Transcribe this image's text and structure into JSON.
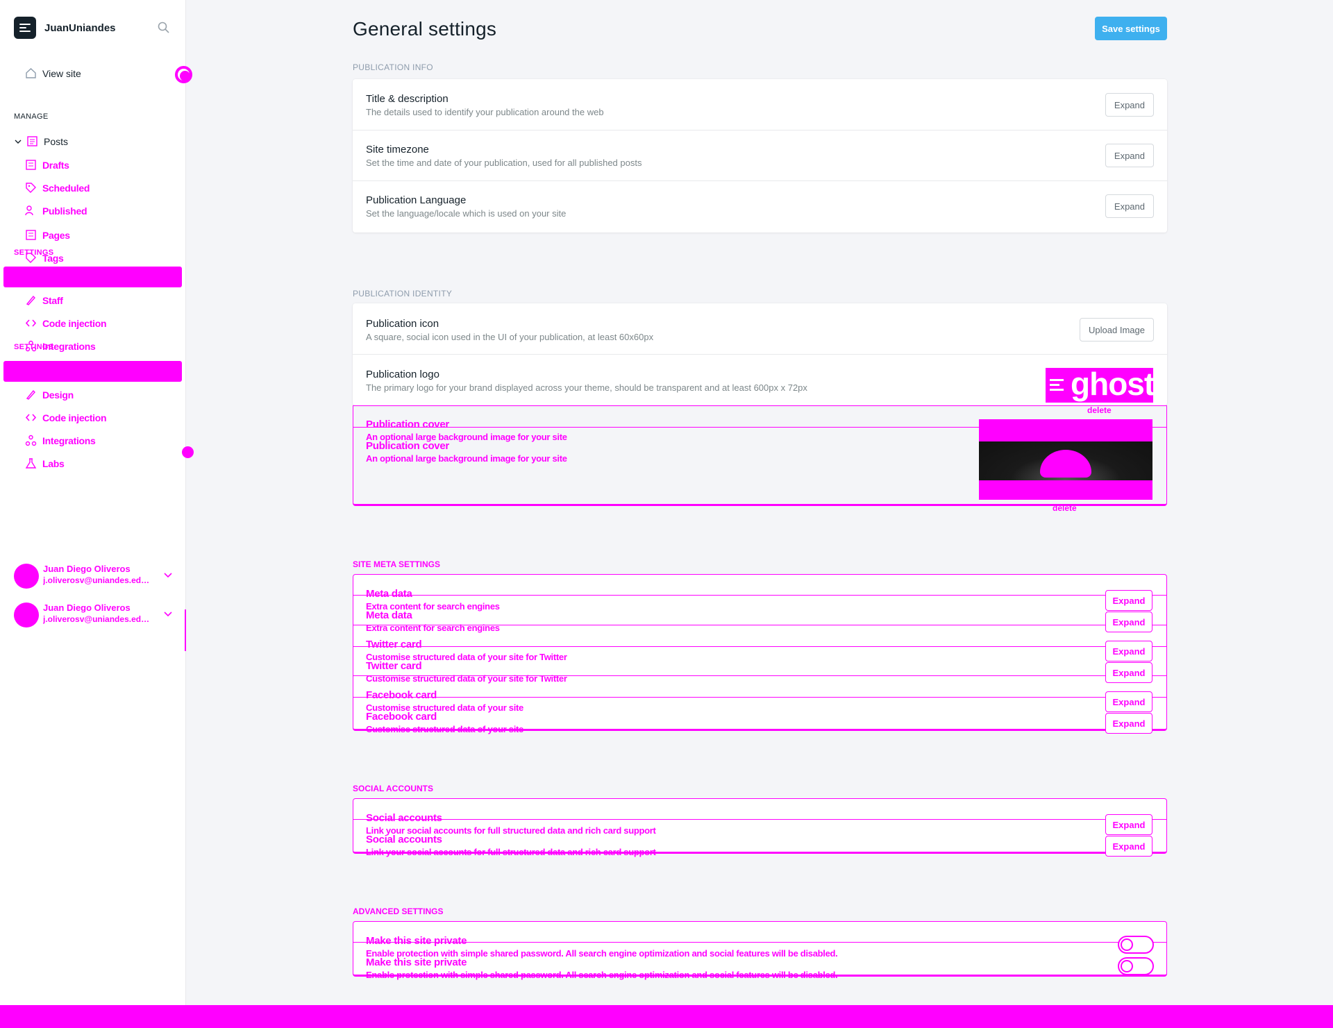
{
  "sidebar": {
    "brand": "JuanUniandes",
    "view_site": "View site",
    "manage_heading": "MANAGE",
    "posts": "Posts",
    "drafts": "Drafts",
    "scheduled": "Scheduled",
    "published": "Published",
    "pages": "Pages",
    "settings_heading": "SETTINGS",
    "tags": "Tags",
    "staff": "Staff",
    "design": "Design",
    "code_injection": "Code injection",
    "integrations": "Integrations",
    "labs": "Labs",
    "user": {
      "name": "Juan Diego Oliveros",
      "email": "j.oliverosv@uniandes.edu.co"
    }
  },
  "main": {
    "title": "General settings",
    "save_label": "Save settings",
    "expand_label": "Expand",
    "publication_info": {
      "label": "PUBLICATION INFO",
      "rows": [
        {
          "title": "Title & description",
          "desc": "The details used to identify your publication around the web"
        },
        {
          "title": "Site timezone",
          "desc": "Set the time and date of your publication, used for all published posts"
        },
        {
          "title": "Publication Language",
          "desc": "Set the language/locale which is used on your site"
        }
      ]
    },
    "publication_identity": {
      "label": "PUBLICATION IDENTITY",
      "icon_title": "Publication icon",
      "icon_desc": "A square, social icon used in the UI of your publication, at least 60x60px",
      "upload_label": "Upload Image",
      "logo_title": "Publication logo",
      "logo_desc": "The primary logo for your brand displayed across your theme, should be transparent and at least 600px x 72px",
      "logo_text": "ghost",
      "delete_label": "delete",
      "cover_title": "Publication cover",
      "cover_desc": "An optional large background image for your site"
    },
    "site_meta": {
      "label": "SITE META SETTINGS",
      "rows": [
        {
          "title": "Meta data",
          "desc": "Extra content for search engines"
        },
        {
          "title": "Twitter card",
          "desc": "Customise structured data of your site for Twitter"
        },
        {
          "title": "Facebook card",
          "desc": "Customise structured data of your site"
        }
      ]
    },
    "social": {
      "label": "SOCIAL ACCOUNTS",
      "title": "Social accounts",
      "desc": "Link your social accounts for full structured data and rich card support"
    },
    "advanced": {
      "label": "ADVANCED SETTINGS",
      "title": "Make this site private",
      "desc": "Enable protection with simple shared password. All search engine optimization and social features will be disabled."
    }
  },
  "colors": {
    "accent": "#3eb0ef",
    "overlay": "#ff00ff",
    "text": "#15212a"
  }
}
